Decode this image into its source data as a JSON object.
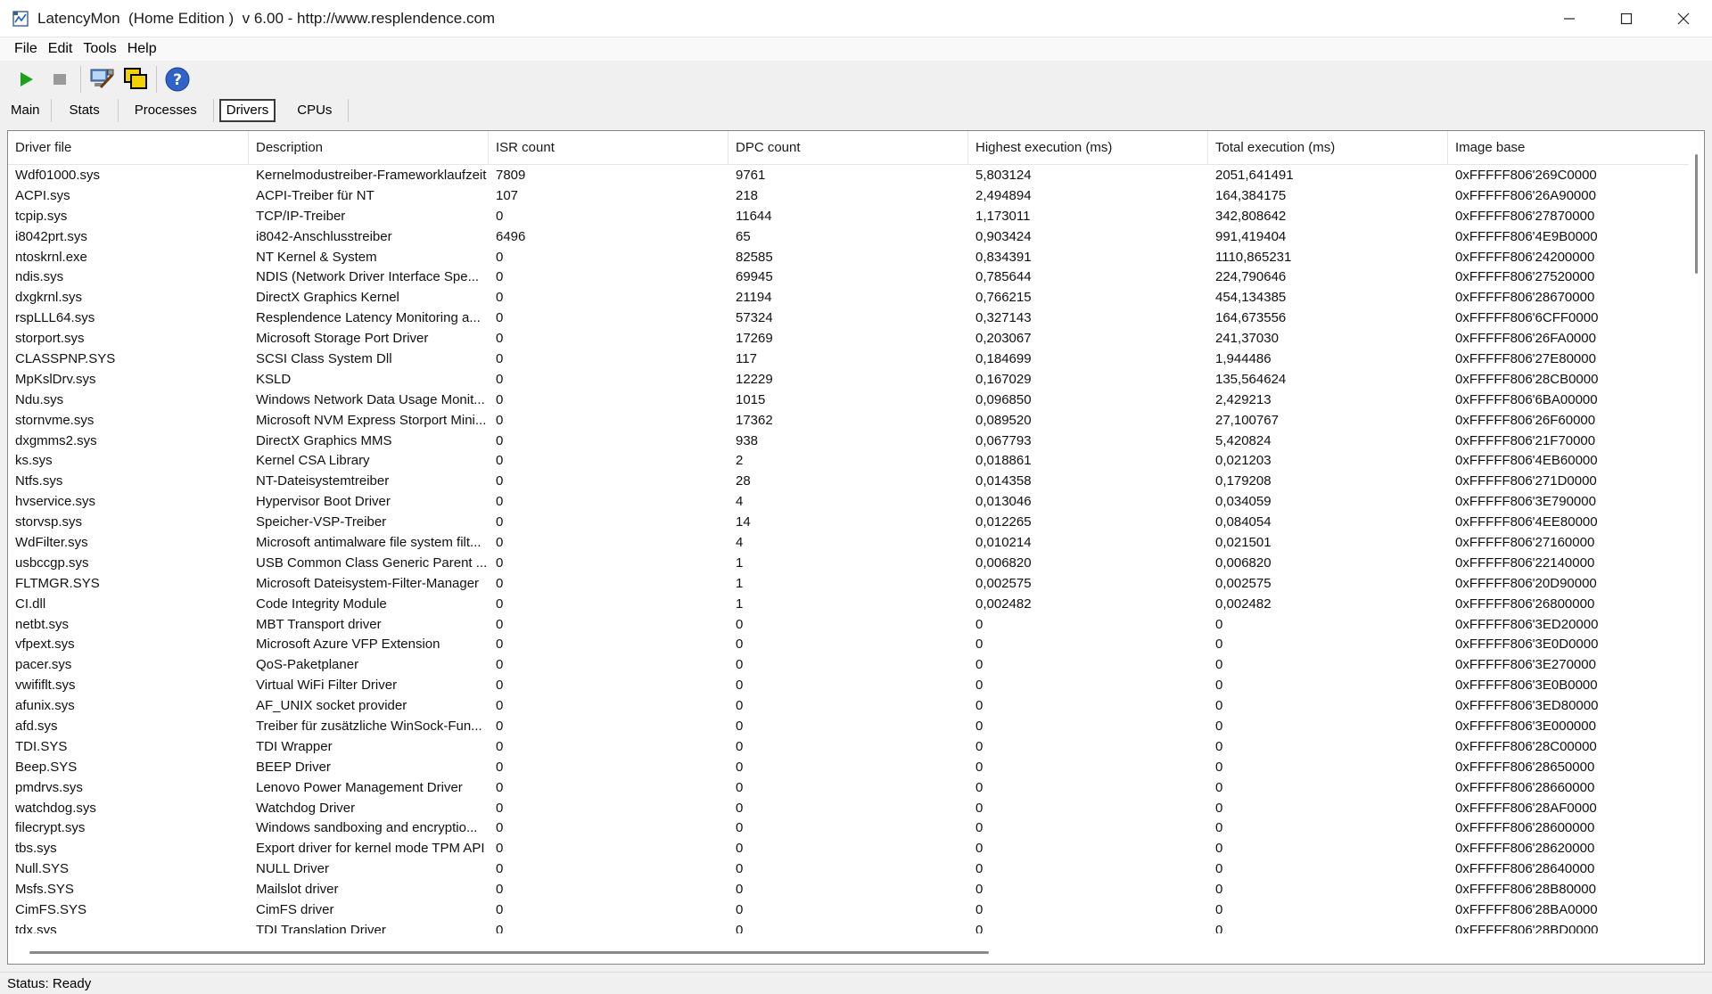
{
  "window": {
    "title": "LatencyMon  (Home Edition )  v 6.00 - http://www.resplendence.com",
    "minimize_icon": "minimize-icon",
    "maximize_icon": "maximize-icon",
    "close_icon": "close-icon"
  },
  "menu": [
    "File",
    "Edit",
    "Tools",
    "Help"
  ],
  "toolbar": {
    "play_icon": "play-icon",
    "stop_icon": "stop-icon",
    "tools_icon": "computer-tools-icon",
    "windows_icon": "overlap-windows-icon",
    "help_icon": "help-icon",
    "colors": {
      "play": "#1aa31a",
      "stop": "#9a9a9a",
      "help": "#2f63c8",
      "windows": "#f5d000"
    }
  },
  "tabs": [
    "Main",
    "Stats",
    "Processes",
    "Drivers",
    "CPUs"
  ],
  "active_tab": "Drivers",
  "table": {
    "headers": [
      "Driver file",
      "Description",
      "ISR count",
      "DPC count",
      "Highest execution (ms)",
      "Total execution (ms)",
      "Image base"
    ],
    "rows": [
      [
        "Wdf01000.sys",
        "Kernelmodustreiber-Frameworklaufzeit",
        "7809",
        "9761",
        "5,803124",
        "2051,641491",
        "0xFFFFF806'269C0000"
      ],
      [
        "ACPI.sys",
        "ACPI-Treiber für NT",
        "107",
        "218",
        "2,494894",
        "164,384175",
        "0xFFFFF806'26A90000"
      ],
      [
        "tcpip.sys",
        "TCP/IP-Treiber",
        "0",
        "11644",
        "1,173011",
        "342,808642",
        "0xFFFFF806'27870000"
      ],
      [
        "i8042prt.sys",
        "i8042-Anschlusstreiber",
        "6496",
        "65",
        "0,903424",
        "991,419404",
        "0xFFFFF806'4E9B0000"
      ],
      [
        "ntoskrnl.exe",
        "NT Kernel & System",
        "0",
        "82585",
        "0,834391",
        "1110,865231",
        "0xFFFFF806'24200000"
      ],
      [
        "ndis.sys",
        "NDIS (Network Driver Interface Spe...",
        "0",
        "69945",
        "0,785644",
        "224,790646",
        "0xFFFFF806'27520000"
      ],
      [
        "dxgkrnl.sys",
        "DirectX Graphics Kernel",
        "0",
        "21194",
        "0,766215",
        "454,134385",
        "0xFFFFF806'28670000"
      ],
      [
        "rspLLL64.sys",
        "Resplendence Latency Monitoring a...",
        "0",
        "57324",
        "0,327143",
        "164,673556",
        "0xFFFFF806'6CFF0000"
      ],
      [
        "storport.sys",
        "Microsoft Storage Port Driver",
        "0",
        "17269",
        "0,203067",
        "241,37030",
        "0xFFFFF806'26FA0000"
      ],
      [
        "CLASSPNP.SYS",
        "SCSI Class System Dll",
        "0",
        "117",
        "0,184699",
        "1,944486",
        "0xFFFFF806'27E80000"
      ],
      [
        "MpKslDrv.sys",
        "KSLD",
        "0",
        "12229",
        "0,167029",
        "135,564624",
        "0xFFFFF806'28CB0000"
      ],
      [
        "Ndu.sys",
        "Windows Network Data Usage Monit...",
        "0",
        "1015",
        "0,096850",
        "2,429213",
        "0xFFFFF806'6BA00000"
      ],
      [
        "stornvme.sys",
        "Microsoft NVM Express Storport Mini...",
        "0",
        "17362",
        "0,089520",
        "27,100767",
        "0xFFFFF806'26F60000"
      ],
      [
        "dxgmms2.sys",
        "DirectX Graphics MMS",
        "0",
        "938",
        "0,067793",
        "5,420824",
        "0xFFFFF806'21F70000"
      ],
      [
        "ks.sys",
        "Kernel CSA Library",
        "0",
        "2",
        "0,018861",
        "0,021203",
        "0xFFFFF806'4EB60000"
      ],
      [
        "Ntfs.sys",
        "NT-Dateisystemtreiber",
        "0",
        "28",
        "0,014358",
        "0,179208",
        "0xFFFFF806'271D0000"
      ],
      [
        "hvservice.sys",
        "Hypervisor Boot Driver",
        "0",
        "4",
        "0,013046",
        "0,034059",
        "0xFFFFF806'3E790000"
      ],
      [
        "storvsp.sys",
        "Speicher-VSP-Treiber",
        "0",
        "14",
        "0,012265",
        "0,084054",
        "0xFFFFF806'4EE80000"
      ],
      [
        "WdFilter.sys",
        "Microsoft antimalware file system filt...",
        "0",
        "4",
        "0,010214",
        "0,021501",
        "0xFFFFF806'27160000"
      ],
      [
        "usbccgp.sys",
        "USB Common Class Generic Parent ...",
        "0",
        "1",
        "0,006820",
        "0,006820",
        "0xFFFFF806'22140000"
      ],
      [
        "FLTMGR.SYS",
        "Microsoft Dateisystem-Filter-Manager",
        "0",
        "1",
        "0,002575",
        "0,002575",
        "0xFFFFF806'20D90000"
      ],
      [
        "CI.dll",
        "Code Integrity Module",
        "0",
        "1",
        "0,002482",
        "0,002482",
        "0xFFFFF806'26800000"
      ],
      [
        "netbt.sys",
        "MBT Transport driver",
        "0",
        "0",
        "0",
        "0",
        "0xFFFFF806'3ED20000"
      ],
      [
        "vfpext.sys",
        "Microsoft Azure VFP Extension",
        "0",
        "0",
        "0",
        "0",
        "0xFFFFF806'3E0D0000"
      ],
      [
        "pacer.sys",
        "QoS-Paketplaner",
        "0",
        "0",
        "0",
        "0",
        "0xFFFFF806'3E270000"
      ],
      [
        "vwififlt.sys",
        "Virtual WiFi Filter Driver",
        "0",
        "0",
        "0",
        "0",
        "0xFFFFF806'3E0B0000"
      ],
      [
        "afunix.sys",
        "AF_UNIX socket provider",
        "0",
        "0",
        "0",
        "0",
        "0xFFFFF806'3ED80000"
      ],
      [
        "afd.sys",
        "Treiber für zusätzliche WinSock-Fun...",
        "0",
        "0",
        "0",
        "0",
        "0xFFFFF806'3E000000"
      ],
      [
        "TDI.SYS",
        "TDI Wrapper",
        "0",
        "0",
        "0",
        "0",
        "0xFFFFF806'28C00000"
      ],
      [
        "Beep.SYS",
        "BEEP Driver",
        "0",
        "0",
        "0",
        "0",
        "0xFFFFF806'28650000"
      ],
      [
        "pmdrvs.sys",
        "Lenovo Power Management Driver",
        "0",
        "0",
        "0",
        "0",
        "0xFFFFF806'28660000"
      ],
      [
        "watchdog.sys",
        "Watchdog Driver",
        "0",
        "0",
        "0",
        "0",
        "0xFFFFF806'28AF0000"
      ],
      [
        "filecrypt.sys",
        "Windows sandboxing and encryptio...",
        "0",
        "0",
        "0",
        "0",
        "0xFFFFF806'28600000"
      ],
      [
        "tbs.sys",
        "Export driver for kernel mode TPM API",
        "0",
        "0",
        "0",
        "0",
        "0xFFFFF806'28620000"
      ],
      [
        "Null.SYS",
        "NULL Driver",
        "0",
        "0",
        "0",
        "0",
        "0xFFFFF806'28640000"
      ],
      [
        "Msfs.SYS",
        "Mailslot driver",
        "0",
        "0",
        "0",
        "0",
        "0xFFFFF806'28B80000"
      ],
      [
        "CimFS.SYS",
        "CimFS driver",
        "0",
        "0",
        "0",
        "0",
        "0xFFFFF806'28BA0000"
      ],
      [
        "tdx.sys",
        "TDI Translation Driver",
        "0",
        "0",
        "0",
        "0",
        "0xFFFFF806'28BD0000"
      ]
    ]
  },
  "status": "Status: Ready"
}
